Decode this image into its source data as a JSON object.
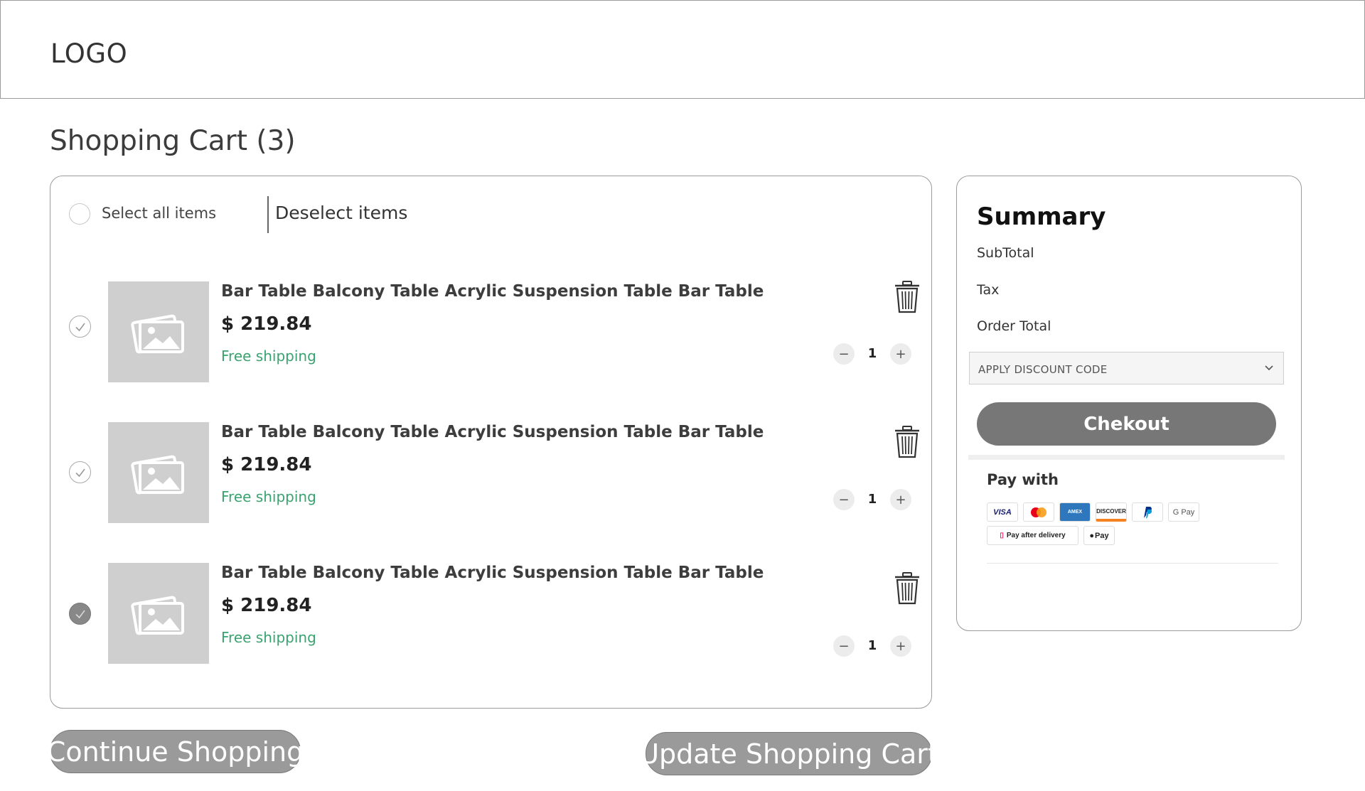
{
  "header": {
    "logo": "LOGO"
  },
  "page": {
    "title": "Shopping Cart (3)"
  },
  "cart": {
    "select_all_label": "Select all items",
    "deselect_label": "Deselect items",
    "items": [
      {
        "title": "Bar Table Balcony Table Acrylic Suspension Table Bar Table",
        "price": "$ 219.84",
        "shipping": "Free shipping",
        "qty": "1",
        "selected": false
      },
      {
        "title": "Bar Table Balcony Table Acrylic Suspension Table Bar Table",
        "price": "$ 219.84",
        "shipping": "Free shipping",
        "qty": "1",
        "selected": false
      },
      {
        "title": "Bar Table Balcony Table Acrylic Suspension Table Bar Table",
        "price": "$ 219.84",
        "shipping": "Free shipping",
        "qty": "1",
        "selected": true
      }
    ],
    "qty_minus": "−",
    "qty_plus": "+"
  },
  "actions": {
    "continue_label": "Continue Shopping",
    "update_label": "Update Shopping Cart"
  },
  "summary": {
    "title": "Summary",
    "subtotal_label": "SubTotal",
    "tax_label": "Tax",
    "order_total_label": "Order Total",
    "discount_label": "APPLY DISCOUNT CODE",
    "checkout_label": "Chekout",
    "pay_with_label": "Pay with",
    "payment_methods_row1": [
      "VISA",
      "Mastercard",
      "AMEX",
      "DISCOVER",
      "PayPal",
      "G Pay"
    ],
    "payment_methods_row2": [
      "Pay after delivery",
      "Pay"
    ]
  },
  "colors": {
    "shipping_green": "#3aa36f",
    "button_grey": "#9a9a9a",
    "checkout_grey": "#777777",
    "thumb_grey": "#cfcfcf"
  },
  "icons": [
    "check-icon",
    "image-placeholder-icon",
    "trash-icon",
    "chevron-down-icon"
  ]
}
